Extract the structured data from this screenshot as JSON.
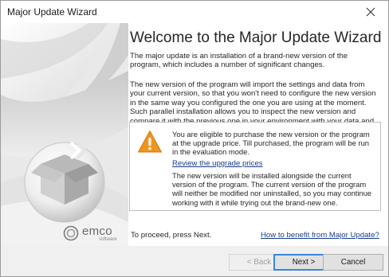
{
  "window": {
    "title": "Major Update Wizard"
  },
  "header": {
    "title": "Welcome to the Major Update Wizard"
  },
  "intro": {
    "paragraph1": "The major update is an installation of a brand-new version of the program, which includes a number of significant changes.",
    "paragraph2": "The new version of the program will import the settings and data from your current version, so that you won't need to configure the new version in the same way you configured the one you are using at the moment. Such parallel installation allows you to inspect the new version and compare it with the previous one in your environment with your data and settings."
  },
  "notice": {
    "icon": "warning-icon",
    "text1": "You are eligible to purchase the new version or the program at the upgrade price. Till purchased, the program will be run in the evaluation mode.",
    "link": "Review the upgrade prices",
    "text2": "The new version will be installed alongside the current version of the program. The current version of the program will neither be modified nor uninstalled, so you may continue working with it while trying out the brand-new one."
  },
  "brand": {
    "name": "emco",
    "tagline": "software"
  },
  "bottom": {
    "proceed": "To proceed, press Next.",
    "link": "How to benefit from Major Update?"
  },
  "buttons": {
    "back": "< Back",
    "next": "Next >",
    "cancel": "Cancel"
  },
  "colors": {
    "link": "#1a3d8f",
    "warning": "#f0941e",
    "default_button_border": "#3c86d8"
  }
}
